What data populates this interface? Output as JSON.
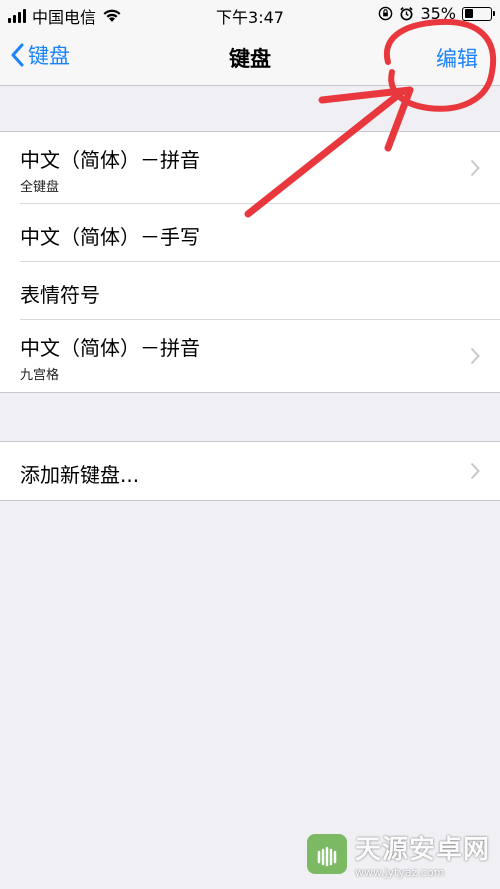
{
  "status_bar": {
    "carrier": "中国电信",
    "time": "下午3:47",
    "battery": "35%",
    "battery_level": 0.35
  },
  "nav": {
    "back_label": "键盘",
    "title": "键盘",
    "edit_label": "编辑"
  },
  "keyboards": [
    {
      "title": "中文（简体）－拼音",
      "subtitle": "全键盘",
      "chevron": true
    },
    {
      "title": "中文（简体）－手写",
      "subtitle": "",
      "chevron": false
    },
    {
      "title": "表情符号",
      "subtitle": "",
      "chevron": false
    },
    {
      "title": "中文（简体）－拼音",
      "subtitle": "九宫格",
      "chevron": true
    }
  ],
  "add_keyboard": {
    "label": "添加新键盘..."
  },
  "watermark": {
    "name": "天源安卓网",
    "url": "www.jytyaz.com"
  },
  "colors": {
    "accent": "#1a82fb",
    "background": "#efeff4",
    "annotation": "#e8383d"
  }
}
